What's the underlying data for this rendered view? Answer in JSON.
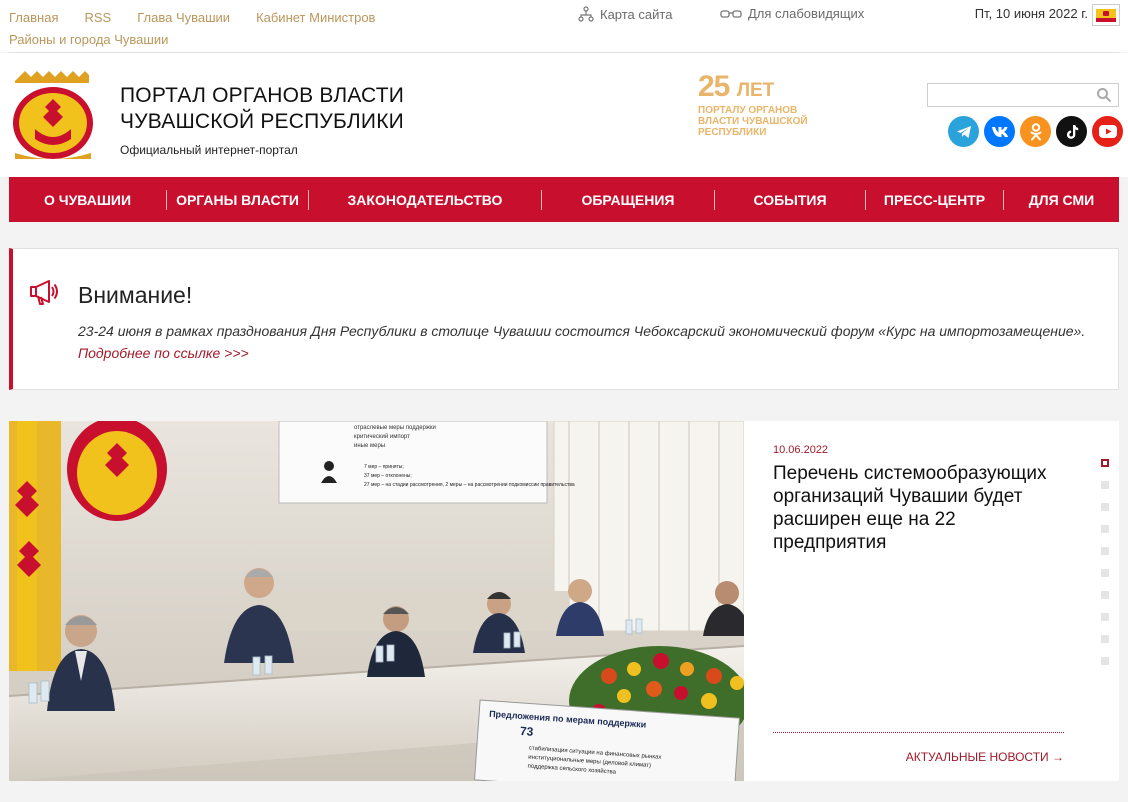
{
  "topbar": {
    "links": [
      "Главная",
      "RSS",
      "Глава Чувашии",
      "Кабинет Министров",
      "Районы и города Чувашии"
    ],
    "sitemap": "Карта сайта",
    "low_vision": "Для слабовидящих",
    "date": "Пт, 10 июня 2022 г."
  },
  "header": {
    "title_line1": "ПОРТАЛ ОРГАНОВ ВЛАСТИ",
    "title_line2": "ЧУВАШСКОЙ РЕСПУБЛИКИ",
    "subtitle": "Официальный интернет-портал",
    "anniversary": {
      "number": "25",
      "unit": "ЛЕТ",
      "line1": "ПОРТАЛУ ОРГАНОВ",
      "line2": "ВЛАСТИ ЧУВАШСКОЙ",
      "line3": "РЕСПУБЛИКИ"
    },
    "search_placeholder": "",
    "social": [
      "telegram-icon",
      "vk-icon",
      "odnoklassniki-icon",
      "tiktok-icon",
      "youtube-icon"
    ]
  },
  "nav": {
    "items": [
      "О ЧУВАШИИ",
      "ОРГАНЫ ВЛАСТИ",
      "ЗАКОНОДАТЕЛЬСТВО",
      "ОБРАЩЕНИЯ",
      "СОБЫТИЯ",
      "ПРЕСС-ЦЕНТР",
      "ДЛЯ СМИ"
    ]
  },
  "notice": {
    "heading": "Внимание!",
    "text": "23-24 июня в рамках празднования Дня Республики в столице Чувашии состоится Чебоксарский экономический форум «Курс на импортозамещение».",
    "link": "Подробнее по ссылке >>>"
  },
  "news": {
    "date": "10.06.2022",
    "title": "Перечень системообразующих организаций Чувашии будет расширен еще на 22 предприятия",
    "more": "АКТУАЛЬНЫЕ НОВОСТИ",
    "slides_total": 10,
    "active_slide": 1,
    "photo_screen": {
      "top_lines": [
        "отраслевые меры поддержки",
        "критический импорт",
        "иные меры"
      ],
      "stats": [
        "7 мер – приняты;",
        "37 мер – отклонены;",
        "27 мер – на стадии рассмотрения, 2 меры – на рассмотрении подкомиссии правительства"
      ],
      "bottom_title": "Предложения по мерам поддержки",
      "bottom_number": "73",
      "bottom_lines": [
        "стабилизация ситуации на финансовых рынках",
        "институциональные меры (деловой климат)",
        "поддержка сельского хозяйства"
      ]
    }
  },
  "colors": {
    "brand_red": "#c8102e",
    "gold_link": "#b9975b",
    "anniversary": "#e8b56a",
    "accent_dark_red": "#a11a2a"
  }
}
